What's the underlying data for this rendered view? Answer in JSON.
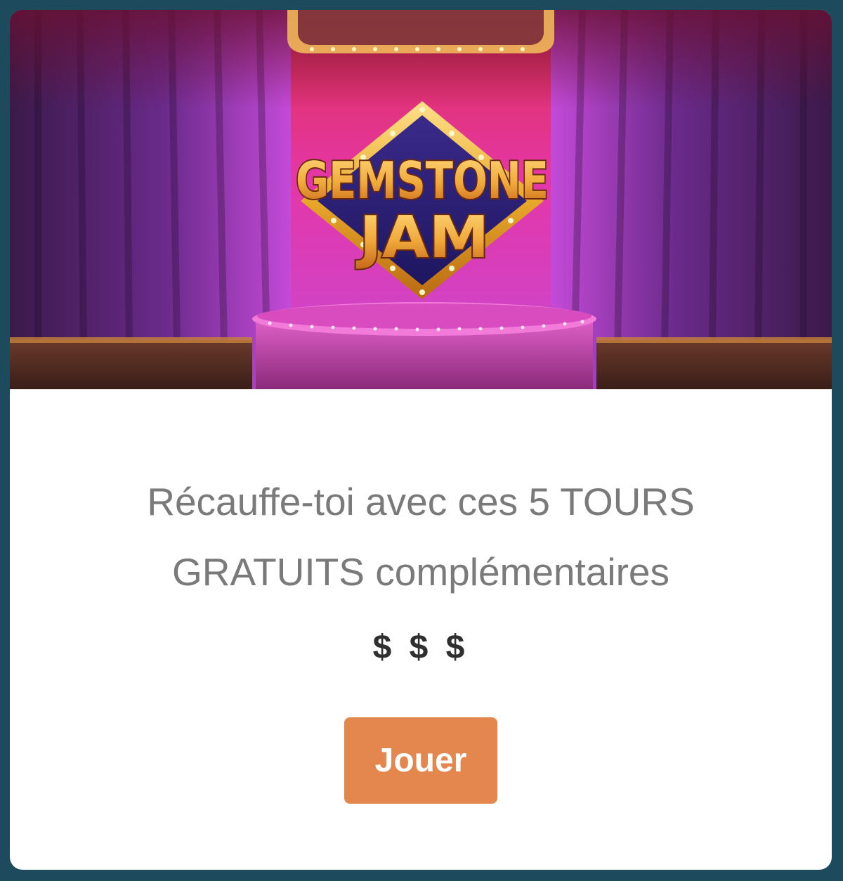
{
  "banner": {
    "logo_line1": "GEMSTONE",
    "logo_line2": "JAM",
    "alt": "Gemstone Jam game banner"
  },
  "offer": {
    "headline_line1": "Récauffe-toi avec ces 5 TOURS",
    "headline_line2": "GRATUITS complémentaires",
    "price_symbols": "$ $ $"
  },
  "actions": {
    "play_label": "Jouer"
  },
  "colors": {
    "page_background": "#1d4a5c",
    "card_background": "#ffffff",
    "button_background": "#e3874f",
    "headline_text": "#7a7a7a",
    "price_text": "#2f2f2f"
  }
}
